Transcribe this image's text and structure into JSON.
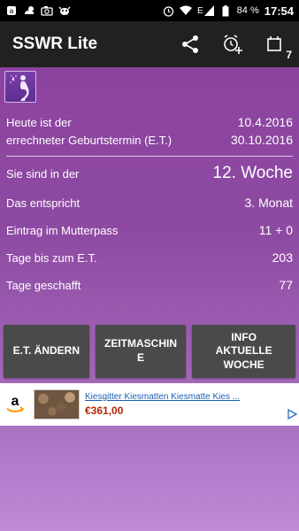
{
  "status_bar": {
    "time": "17:54",
    "battery": "84 %",
    "network": "E",
    "icons_left": [
      "notification-icon",
      "cloud-sun-icon",
      "camera-icon",
      "cow-icon"
    ],
    "icons_right": [
      "alarm-icon",
      "wifi-icon",
      "signal-icon",
      "battery-icon"
    ]
  },
  "appbar": {
    "title": "SSWR Lite",
    "calendar_number": "7",
    "actions": [
      "share-icon",
      "add-alarm-icon",
      "calendar-icon"
    ]
  },
  "info": {
    "today_label": "Heute ist der",
    "today_value": "10.4.2016",
    "due_label": "errechneter Geburtstermin (E.T.)",
    "due_value": "30.10.2016",
    "week_label": "Sie sind in der",
    "week_value": "12. Woche",
    "month_label": "Das entspricht",
    "month_value": "3. Monat",
    "passport_label": "Eintrag im Mutterpass",
    "passport_value": "11 + 0",
    "days_left_label": "Tage bis zum E.T.",
    "days_left_value": "203",
    "days_done_label": "Tage geschafft",
    "days_done_value": "77"
  },
  "buttons": {
    "change_et": "E.T. ÄNDERN",
    "time_machine": "ZEITMASCHINE",
    "info_week": "INFO AKTUELLE WOCHE"
  },
  "ad": {
    "title": "Kiesgitter Kiesmatten Kiesmatte Kies ...",
    "price": "€361,00"
  },
  "colors": {
    "appbar": "#212121",
    "background_top": "#8a3f9d",
    "background_bottom": "#c08ad6",
    "button": "#4a4a4a",
    "ad_link": "#1a5fb4",
    "ad_price": "#b12704"
  }
}
